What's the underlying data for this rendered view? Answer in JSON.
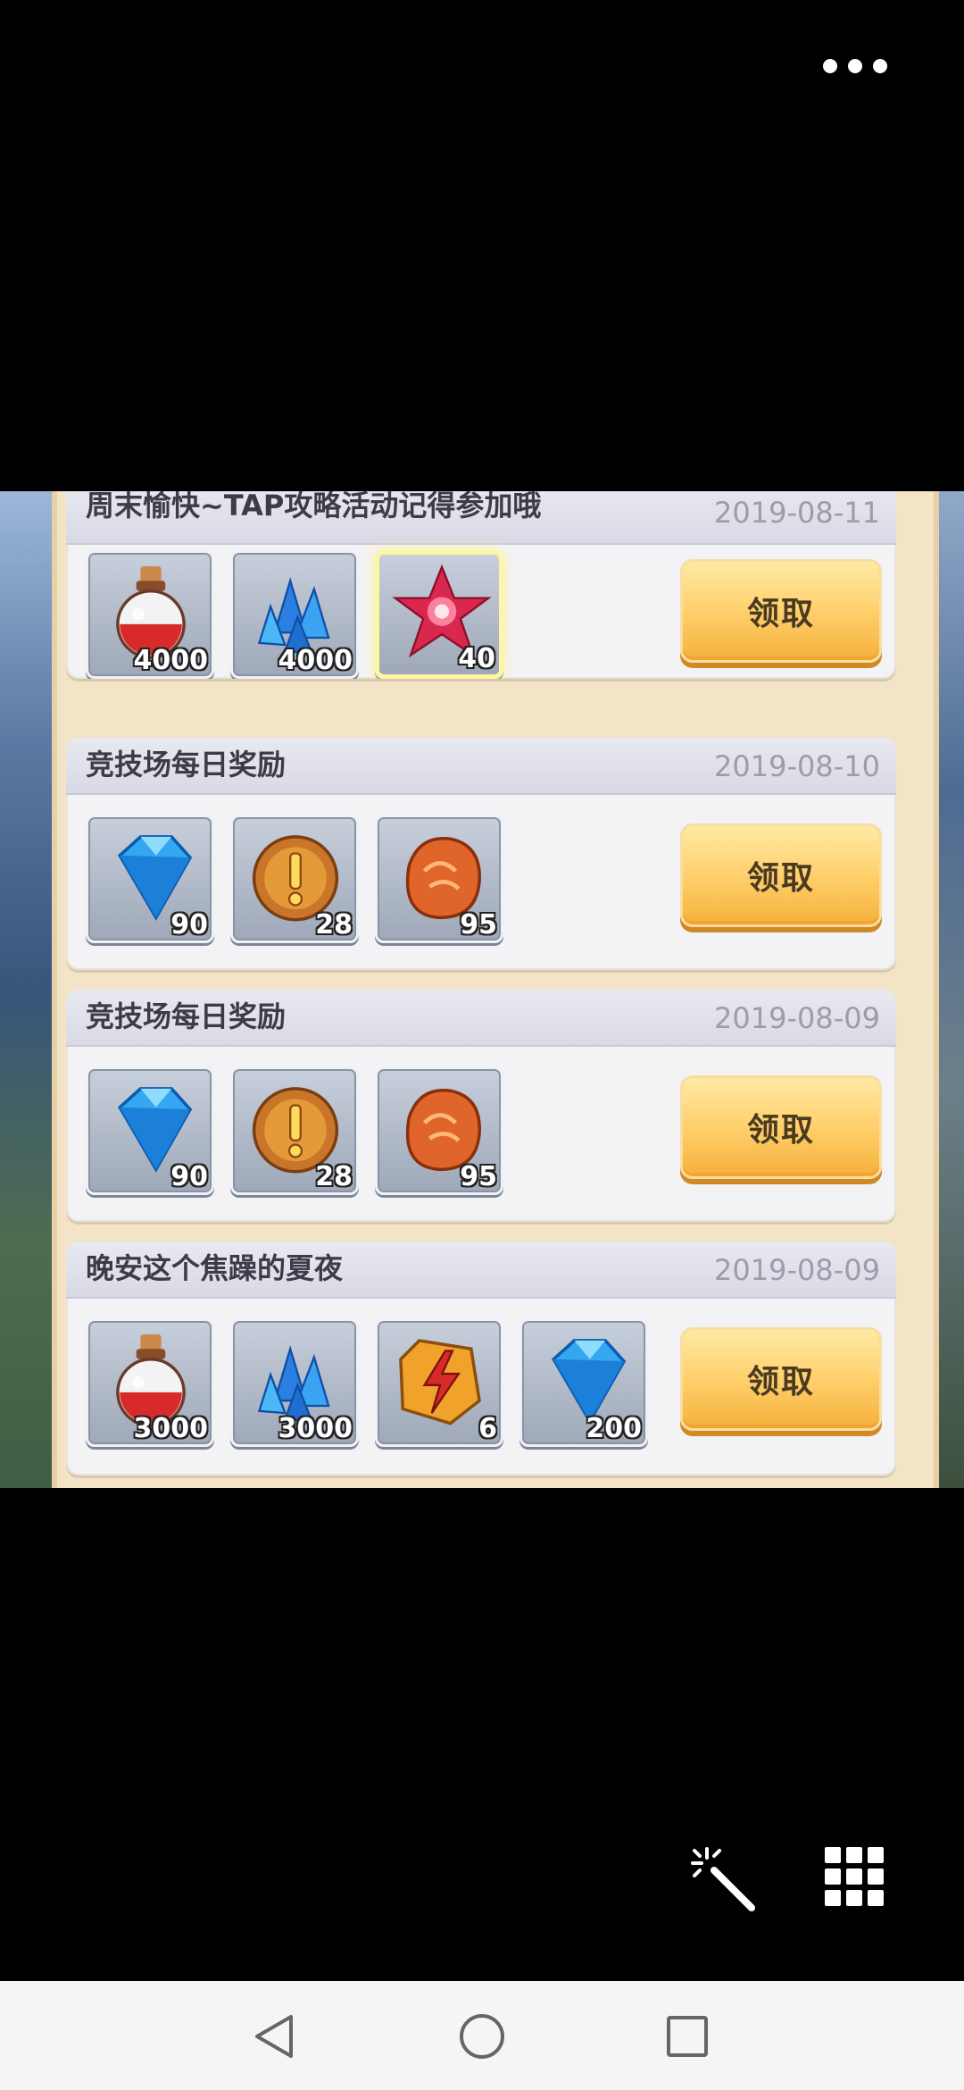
{
  "topbar": {
    "more_icon": "more-dots-icon"
  },
  "claim_label": "领取",
  "mails": [
    {
      "title": "周末愉快~TAP攻略活动记得参加哦",
      "date": "2019-08-11",
      "items": [
        {
          "icon": "red-potion-icon",
          "count": "4000"
        },
        {
          "icon": "blue-crystal-icon",
          "count": "4000"
        },
        {
          "icon": "red-star-gem-icon",
          "count": "40"
        }
      ]
    },
    {
      "title": "竞技场每日奖励",
      "date": "2019-08-10",
      "items": [
        {
          "icon": "blue-diamond-icon",
          "count": "90"
        },
        {
          "icon": "gold-sword-coin-icon",
          "count": "28"
        },
        {
          "icon": "orange-rune-stone-icon",
          "count": "95"
        }
      ]
    },
    {
      "title": "竞技场每日奖励",
      "date": "2019-08-09",
      "items": [
        {
          "icon": "blue-diamond-icon",
          "count": "90"
        },
        {
          "icon": "gold-sword-coin-icon",
          "count": "28"
        },
        {
          "icon": "orange-rune-stone-icon",
          "count": "95"
        }
      ]
    },
    {
      "title": "晚安这个焦躁的夏夜",
      "date": "2019-08-09",
      "items": [
        {
          "icon": "red-potion-icon",
          "count": "3000"
        },
        {
          "icon": "blue-crystal-icon",
          "count": "3000"
        },
        {
          "icon": "lightning-rune-icon",
          "count": "6"
        },
        {
          "icon": "blue-diamond-icon",
          "count": "200"
        }
      ]
    }
  ],
  "floating_tools": {
    "left_icon": "magic-wand-icon",
    "right_icon": "grid-menu-icon"
  },
  "navbar": {
    "back_icon": "back-triangle-icon",
    "home_icon": "home-circle-icon",
    "recent_icon": "recent-square-icon"
  }
}
